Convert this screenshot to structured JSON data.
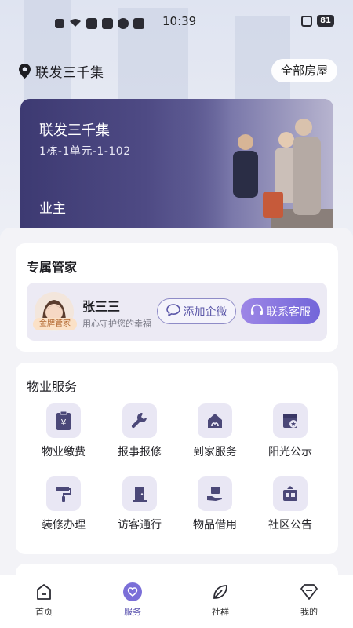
{
  "status_bar": {
    "time": "10:39",
    "battery": "81"
  },
  "header": {
    "location": "联发三千集",
    "all_houses_button": "全部房屋"
  },
  "house": {
    "name": "联发三千集",
    "unit": "1栋-1单元-1-102",
    "role": "业主"
  },
  "butler": {
    "section_title": "专属管家",
    "name": "张三三",
    "motto": "用心守护您的幸福",
    "badge": "金牌管家",
    "add_wechat_button": "添加企微",
    "contact_service_button": "联系客服"
  },
  "property_services": {
    "section_title": "物业服务",
    "items": [
      {
        "label": "物业缴费",
        "icon": "yuan-clipboard-icon"
      },
      {
        "label": "报事报修",
        "icon": "wrench-icon"
      },
      {
        "label": "到家服务",
        "icon": "home-service-icon"
      },
      {
        "label": "阳光公示",
        "icon": "calendar-notice-icon"
      },
      {
        "label": "装修办理",
        "icon": "paint-roller-icon"
      },
      {
        "label": "访客通行",
        "icon": "door-icon"
      },
      {
        "label": "物品借用",
        "icon": "hand-box-icon"
      },
      {
        "label": "社区公告",
        "icon": "bulletin-icon"
      }
    ]
  },
  "bottom_nav": {
    "items": [
      {
        "label": "首页",
        "icon": "home-icon"
      },
      {
        "label": "服务",
        "icon": "heart-service-icon"
      },
      {
        "label": "社群",
        "icon": "leaf-icon"
      },
      {
        "label": "我的",
        "icon": "diamond-icon"
      }
    ],
    "active": "服务",
    "accent_color": "#6b5fd0"
  }
}
